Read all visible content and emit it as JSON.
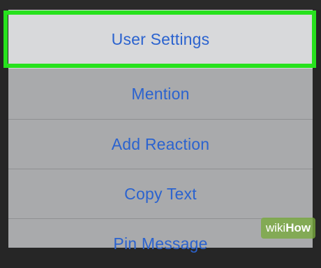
{
  "menu": {
    "items": [
      {
        "label": "User Settings",
        "highlighted": true
      },
      {
        "label": "Mention"
      },
      {
        "label": "Add Reaction"
      },
      {
        "label": "Copy Text"
      },
      {
        "label": "Pin Message"
      }
    ]
  },
  "watermark": {
    "prefix": "wiki",
    "suffix": "How"
  },
  "colors": {
    "item_text": "#2b63cf",
    "highlight_border": "#27e21d",
    "sheet_background": "#a9aaac",
    "selected_background": "#d8d9db",
    "page_background": "#262626"
  }
}
